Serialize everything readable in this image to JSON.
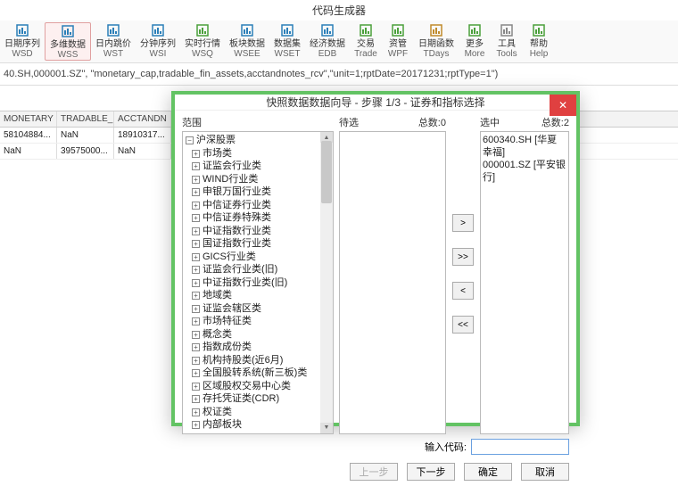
{
  "app_title": "代码生成器",
  "ribbon": [
    {
      "l1": "日期序列",
      "l2": "WSD",
      "sel": false,
      "clr": "#2b7fb8"
    },
    {
      "l1": "多维数据",
      "l2": "WSS",
      "sel": true,
      "clr": "#2b7fb8"
    },
    {
      "l1": "日内跳价",
      "l2": "WST",
      "sel": false,
      "clr": "#2b7fb8"
    },
    {
      "l1": "分钟序列",
      "l2": "WSI",
      "sel": false,
      "clr": "#2b7fb8"
    },
    {
      "l1": "实时行情",
      "l2": "WSQ",
      "sel": false,
      "clr": "#4aa03a"
    },
    {
      "l1": "板块数据",
      "l2": "WSEE",
      "sel": false,
      "clr": "#2b7fb8"
    },
    {
      "l1": "数据集",
      "l2": "WSET",
      "sel": false,
      "clr": "#2b7fb8"
    },
    {
      "l1": "经济数据",
      "l2": "EDB",
      "sel": false,
      "clr": "#2b7fb8"
    },
    {
      "l1": "交易",
      "l2": "Trade",
      "sel": false,
      "clr": "#4aa03a"
    },
    {
      "l1": "资管",
      "l2": "WPF",
      "sel": false,
      "clr": "#4aa03a"
    },
    {
      "l1": "日期函数",
      "l2": "TDays",
      "sel": false,
      "clr": "#c08a2a"
    },
    {
      "l1": "更多",
      "l2": "More",
      "sel": false,
      "clr": "#4aa03a"
    },
    {
      "l1": "工具",
      "l2": "Tools",
      "sel": false,
      "clr": "#888"
    },
    {
      "l1": "帮助",
      "l2": "Help",
      "sel": false,
      "clr": "#4aa03a"
    }
  ],
  "formula": "40.SH,000001.SZ\", \"monetary_cap,tradable_fin_assets,acctandnotes_rcv\",\"unit=1;rptDate=20171231;rptType=1\")",
  "grid": {
    "headers": [
      "MONETARY",
      "TRADABLE_F",
      "ACCTANDN"
    ],
    "rows": [
      [
        "58104884...",
        "NaN",
        "18910317..."
      ],
      [
        "NaN",
        "39575000...",
        "NaN"
      ]
    ]
  },
  "dialog": {
    "title": "快照数据数据向导 - 步骤 1/3 - 证券和指标选择",
    "range_label": "范围",
    "pending_label": "待选",
    "pending_count_label": "总数:0",
    "selected_label": "选中",
    "selected_count_label": "总数:2",
    "tree_root": "沪深股票",
    "tree_nodes": [
      "市场类",
      "证监会行业类",
      "WIND行业类",
      "申银万国行业类",
      "中信证券行业类",
      "中信证券特殊类",
      "中证指数行业类",
      "国证指数行业类",
      "GICS行业类",
      "证监会行业类(旧)",
      "中证指数行业类(旧)",
      "地域类",
      "证监会辖区类",
      "市场特征类",
      "概念类",
      "指数成份类",
      "机构持股类(近6月)",
      "全国股转系统(新三板)类",
      "区域股权交易中心类",
      "存托凭证类(CDR)",
      "权证类",
      "内部板块"
    ],
    "selected_items": [
      "600340.SH [华夏幸福]",
      "000001.SZ [平安银行]"
    ],
    "move": {
      "r": ">",
      "rr": ">>",
      "l": "<",
      "ll": "<<"
    },
    "code_label": "输入代码:",
    "code_value": "",
    "buttons": {
      "prev": "上一步",
      "next": "下一步",
      "ok": "确定",
      "cancel": "取消"
    }
  }
}
